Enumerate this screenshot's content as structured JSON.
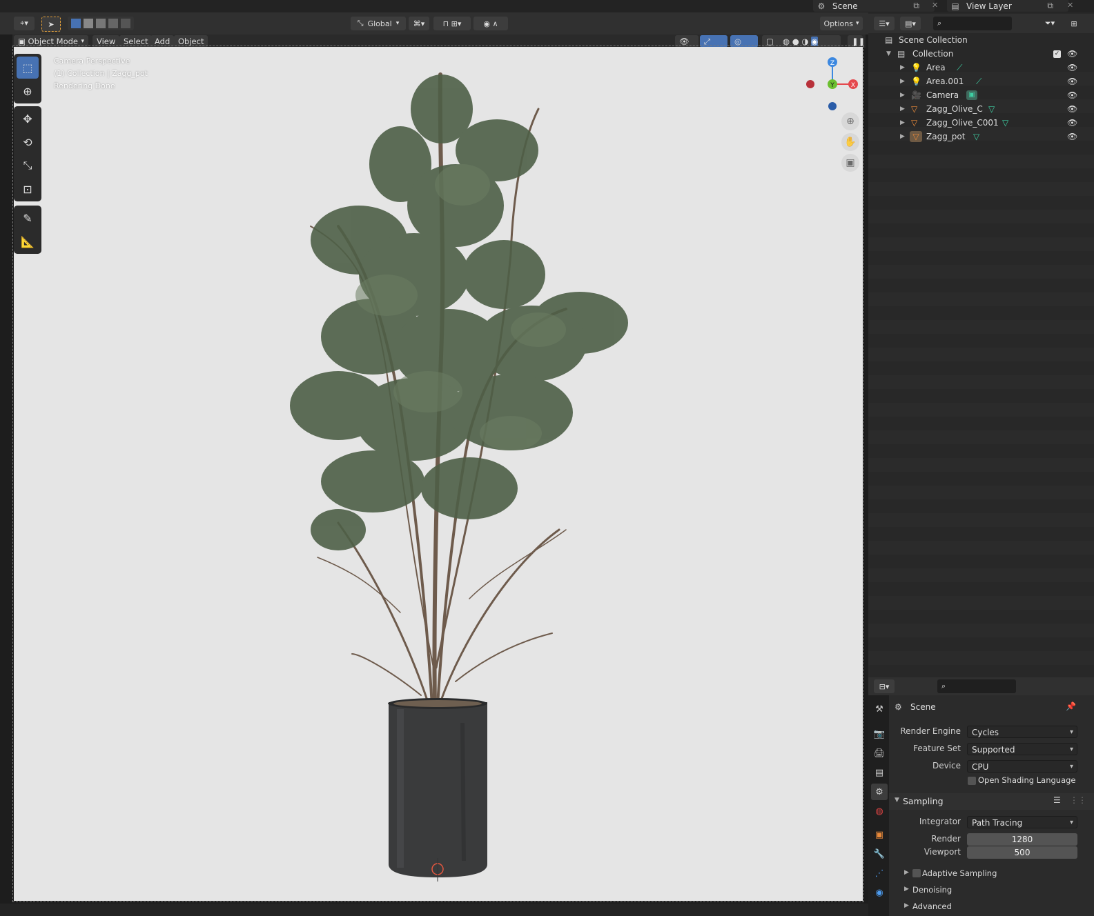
{
  "topbar": {
    "scene_label": "Scene",
    "view_layer_label": "View Layer"
  },
  "header": {
    "orientation": "Global",
    "options": "Options"
  },
  "viewport_header": {
    "mode": "Object Mode",
    "menus": [
      "View",
      "Select",
      "Add",
      "Object"
    ]
  },
  "viewport": {
    "overlay_lines": [
      "Camera Perspective",
      "(1) Collection | Zagg_pot",
      "Rendering Done"
    ],
    "gizmo": {
      "z": "Z",
      "y": "Y",
      "x": "X"
    }
  },
  "outliner": {
    "scene_collection": "Scene Collection",
    "collection": "Collection",
    "items": [
      {
        "name": "Area",
        "type": "light"
      },
      {
        "name": "Area.001",
        "type": "light"
      },
      {
        "name": "Camera",
        "type": "camera"
      },
      {
        "name": "Zagg_Olive_C",
        "type": "mesh"
      },
      {
        "name": "Zagg_Olive_C001",
        "type": "mesh"
      },
      {
        "name": "Zagg_pot",
        "type": "mesh"
      }
    ]
  },
  "properties": {
    "context": "Scene",
    "render_engine_label": "Render Engine",
    "render_engine": "Cycles",
    "feature_set_label": "Feature Set",
    "feature_set": "Supported",
    "device_label": "Device",
    "device": "CPU",
    "osl_label": "Open Shading Language",
    "sampling_label": "Sampling",
    "integrator_label": "Integrator",
    "integrator": "Path Tracing",
    "render_label": "Render",
    "render_samples": "1280",
    "viewport_label": "Viewport",
    "viewport_samples": "500",
    "adaptive_label": "Adaptive Sampling",
    "denoising_label": "Denoising",
    "advanced_label": "Advanced"
  },
  "colors": {
    "accent": "#4772b3",
    "axis_x": "#e5484d",
    "axis_y": "#6bbf2f",
    "axis_z": "#3c88e0",
    "object_icon": "#e8893a",
    "mesh_data": "#3ecfa3"
  }
}
